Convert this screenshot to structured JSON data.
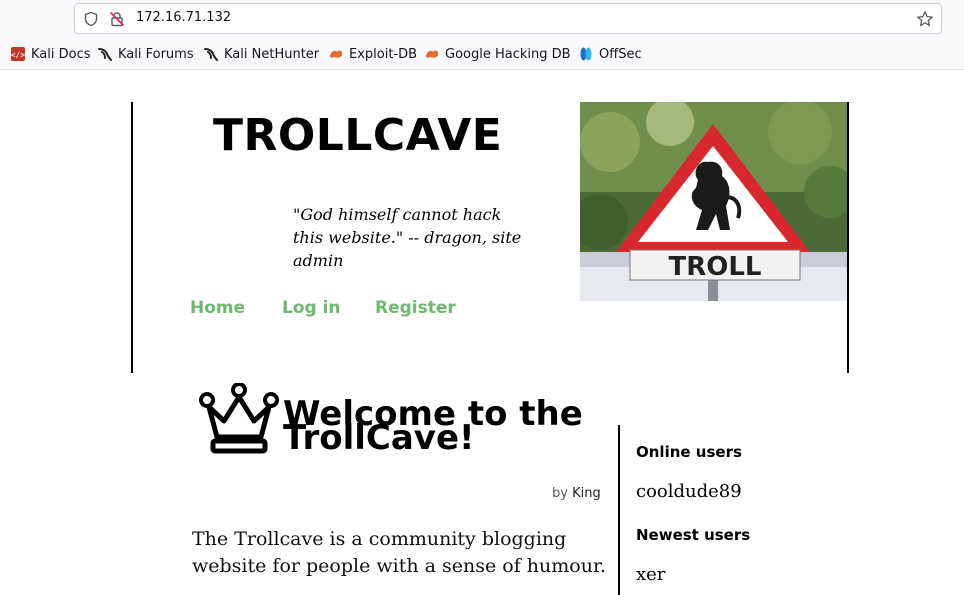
{
  "browser": {
    "url": "172.16.71.132",
    "bookmarks": [
      {
        "label": "Kali Docs",
        "icon": "kali-docs-icon"
      },
      {
        "label": "Kali Forums",
        "icon": "kali-dragon-icon"
      },
      {
        "label": "Kali NetHunter",
        "icon": "kali-dragon-icon"
      },
      {
        "label": "Exploit-DB",
        "icon": "exploit-db-icon"
      },
      {
        "label": "Google Hacking DB",
        "icon": "exploit-db-icon"
      },
      {
        "label": "OffSec",
        "icon": "offsec-icon"
      }
    ]
  },
  "site": {
    "title": "TROLLCAVE",
    "tagline": "\"God himself cannot hack this website.\" -- dragon, site admin",
    "image_caption": "TROLL",
    "nav": [
      "Home",
      "Log in",
      "Register"
    ],
    "accent_color": "#6fb86f"
  },
  "post": {
    "title": "Welcome to the TrollCave!",
    "byline_prefix": "by",
    "author": "King",
    "body": "The Trollcave is a community blogging website for people with a sense of humour."
  },
  "sidebar": {
    "online_heading": "Online users",
    "online_users": [
      "cooldude89"
    ],
    "newest_heading": "Newest users",
    "newest_users": [
      "xer"
    ]
  }
}
